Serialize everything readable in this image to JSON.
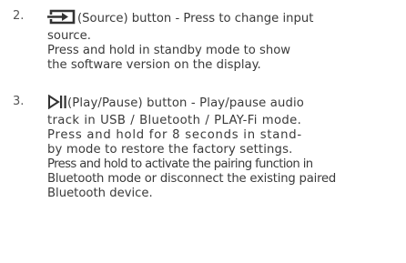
{
  "items": [
    {
      "number": "2.",
      "icon": "source-icon",
      "lines": [
        "(Source) button - Press to change input",
        "source.",
        "Press and hold in standby mode to show",
        "the software version on the display."
      ]
    },
    {
      "number": "3.",
      "icon": "play-pause-icon",
      "lines": [
        "(Play/Pause) button - Play/pause audio",
        "track in USB / Bluetooth / PLAY-Fi mode.",
        "Press and hold for 8 seconds in stand-",
        "by mode to restore the factory settings.",
        "Press and hold to activate the pairing function in",
        "Bluetooth mode or disconnect the existing paired",
        "Bluetooth device."
      ]
    }
  ]
}
